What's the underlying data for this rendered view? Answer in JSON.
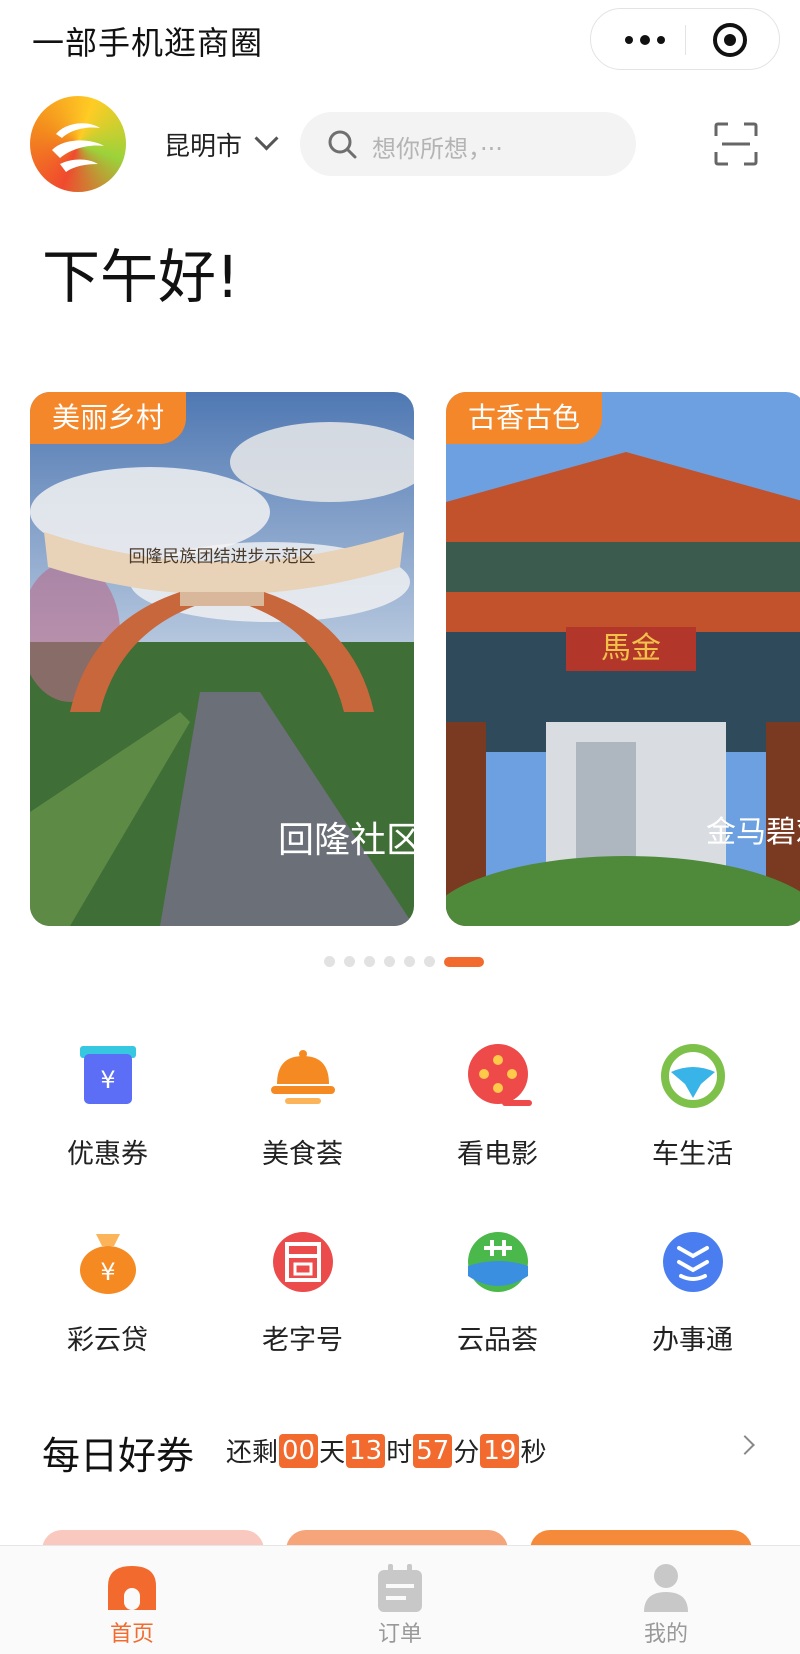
{
  "app_title": "一部手机逛商圈",
  "header": {
    "city": "昆明市",
    "search_placeholder": "想你所想，···"
  },
  "greeting": "下午好!",
  "carousel": {
    "cards": [
      {
        "tag": "美丽乡村",
        "arch_text": "回隆民族团结进步示范区",
        "caption": "回隆社区"
      },
      {
        "tag": "古香古色",
        "plaque_text": "馬金",
        "caption": "金马碧鸡"
      }
    ],
    "page_count": 7,
    "active_index": 6
  },
  "services": [
    {
      "label": "优惠券",
      "icon": "coupon-icon"
    },
    {
      "label": "美食荟",
      "icon": "food-bell-icon"
    },
    {
      "label": "看电影",
      "icon": "film-reel-icon"
    },
    {
      "label": "车生活",
      "icon": "steering-wheel-icon"
    },
    {
      "label": "彩云贷",
      "icon": "money-bag-icon"
    },
    {
      "label": "老字号",
      "icon": "old-brand-icon"
    },
    {
      "label": "云品荟",
      "icon": "yunpin-icon"
    },
    {
      "label": "办事通",
      "icon": "banshitong-icon"
    }
  ],
  "daily_coupon": {
    "title": "每日好券",
    "prefix": "还剩",
    "days": "00",
    "days_unit": "天",
    "hours": "13",
    "hours_unit": "时",
    "minutes": "57",
    "minutes_unit": "分",
    "seconds": "19",
    "seconds_unit": "秒"
  },
  "tabbar": [
    {
      "label": "首页",
      "icon": "home-icon",
      "active": true
    },
    {
      "label": "订单",
      "icon": "order-icon",
      "active": false
    },
    {
      "label": "我的",
      "icon": "profile-icon",
      "active": false
    }
  ],
  "colors": {
    "accent": "#f26a2e",
    "tag": "#f5872b",
    "inactive": "#999999"
  }
}
